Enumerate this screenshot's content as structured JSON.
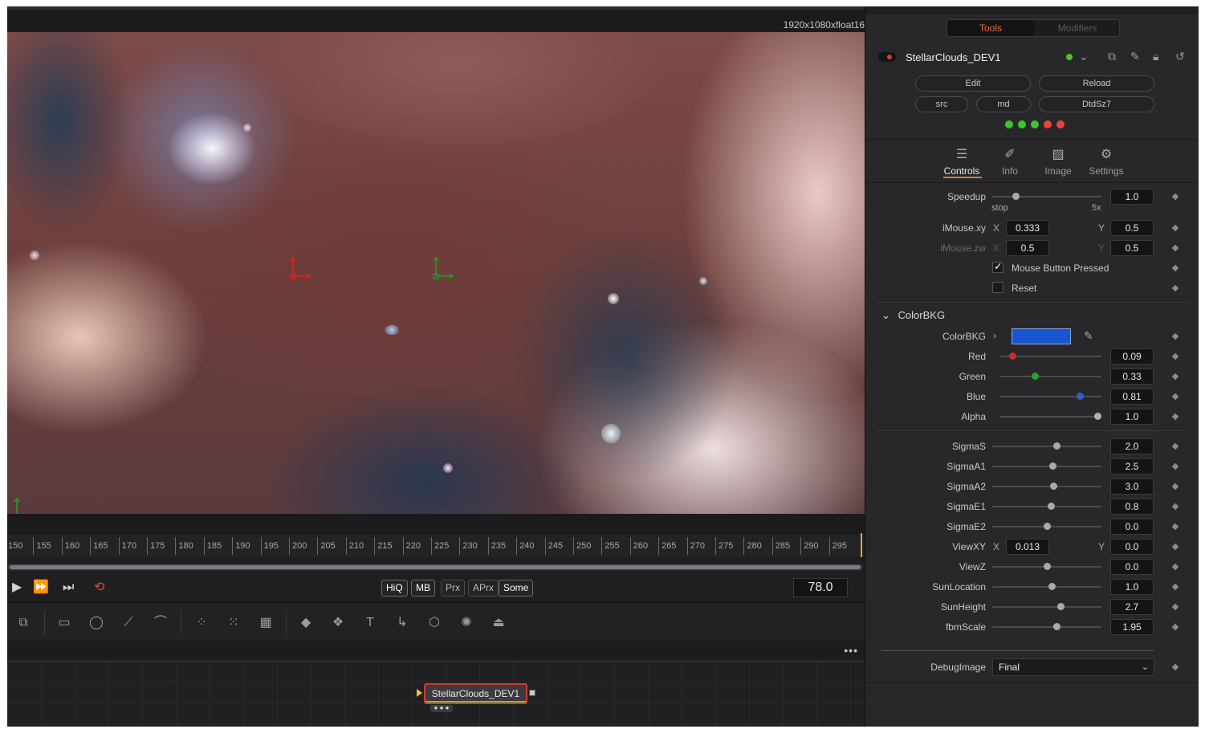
{
  "viewer": {
    "resolution": "1920x1080xfloat16"
  },
  "timeline": {
    "ticks": [
      "150",
      "155",
      "160",
      "165",
      "170",
      "175",
      "180",
      "185",
      "190",
      "195",
      "200",
      "205",
      "210",
      "215",
      "220",
      "225",
      "230",
      "235",
      "240",
      "245",
      "250",
      "255",
      "260",
      "265",
      "270",
      "275",
      "280",
      "285",
      "290",
      "295"
    ],
    "current_frame": "78.0"
  },
  "transport": {
    "quality_buttons": [
      "HiQ",
      "MB",
      "Prx",
      "APrx",
      "Some"
    ]
  },
  "toolbar": {
    "icons": [
      "transform-icon",
      "rectangle-mask-icon",
      "ellipse-mask-icon",
      "polygon-mask-icon",
      "bspline-mask-icon",
      "particle-emitter-icon",
      "particle-render-icon",
      "particle-style-icon",
      "shape-3d-icon",
      "merge-3d-icon",
      "text-3d-icon",
      "camera-3d-icon",
      "render-3d-icon",
      "light-3d-icon",
      "image-plane-icon"
    ]
  },
  "flow": {
    "node_name": "StellarClouds_DEV1"
  },
  "inspector": {
    "tabs": {
      "tools": "Tools",
      "modifiers": "Modifiers"
    },
    "node_name": "StellarClouds_DEV1",
    "buttons": {
      "edit": "Edit",
      "reload": "Reload",
      "src": "src",
      "md": "md",
      "dtdsz7": "DtdSz7"
    },
    "status_dots": [
      "#3ec42a",
      "#3ec42a",
      "#3ec42a",
      "#e8463a",
      "#e8463a"
    ],
    "sub_tabs": {
      "controls": "Controls",
      "info": "Info",
      "image": "Image",
      "settings": "Settings"
    },
    "speedup": {
      "label": "Speedup",
      "value": "1.0",
      "min_label": "stop",
      "max_label": "5x",
      "fraction": 0.2
    },
    "imouse_xy": {
      "label": "iMouse.xy",
      "x_axis": "X",
      "x": "0.333",
      "y_axis": "Y",
      "y": "0.5"
    },
    "imouse_zw": {
      "label": "iMouse.zw",
      "x_axis": "X",
      "x": "0.5",
      "y_axis": "Y",
      "y": "0.5"
    },
    "mouse_button": {
      "label": "Mouse Button Pressed",
      "checked": true
    },
    "reset": {
      "label": "Reset",
      "checked": false
    },
    "group": "ColorBKG",
    "colorbkg": {
      "label": "ColorBKG",
      "swatch": "#1a55d0"
    },
    "red": {
      "label": "Red",
      "value": "0.09",
      "fraction": 0.09,
      "color": "#d02a2a"
    },
    "green": {
      "label": "Green",
      "value": "0.33",
      "fraction": 0.33,
      "color": "#2aa02a"
    },
    "blue": {
      "label": "Blue",
      "value": "0.81",
      "fraction": 0.81,
      "color": "#2a60d0"
    },
    "alpha": {
      "label": "Alpha",
      "value": "1.0",
      "fraction": 1.0,
      "color": "#b0b0b4"
    },
    "sigma_s": {
      "label": "SigmaS",
      "value": "2.0",
      "fraction": 0.6
    },
    "sigma_a1": {
      "label": "SigmaA1",
      "value": "2.5",
      "fraction": 0.56
    },
    "sigma_a2": {
      "label": "SigmaA2",
      "value": "3.0",
      "fraction": 0.57
    },
    "sigma_e1": {
      "label": "SigmaE1",
      "value": "0.8",
      "fraction": 0.54
    },
    "sigma_e2": {
      "label": "SigmaE2",
      "value": "0.0",
      "fraction": 0.5
    },
    "view_xy": {
      "label": "ViewXY",
      "x_axis": "X",
      "x": "0.013",
      "y_axis": "Y",
      "y": "0.0"
    },
    "view_z": {
      "label": "ViewZ",
      "value": "0.0",
      "fraction": 0.5
    },
    "sun_location": {
      "label": "SunLocation",
      "value": "1.0",
      "fraction": 0.55
    },
    "sun_height": {
      "label": "SunHeight",
      "value": "2.7",
      "fraction": 0.64
    },
    "fbm_scale": {
      "label": "fbmScale",
      "value": "1.95",
      "fraction": 0.6
    },
    "debug_image": {
      "label": "DebugImage",
      "value": "Final"
    }
  }
}
